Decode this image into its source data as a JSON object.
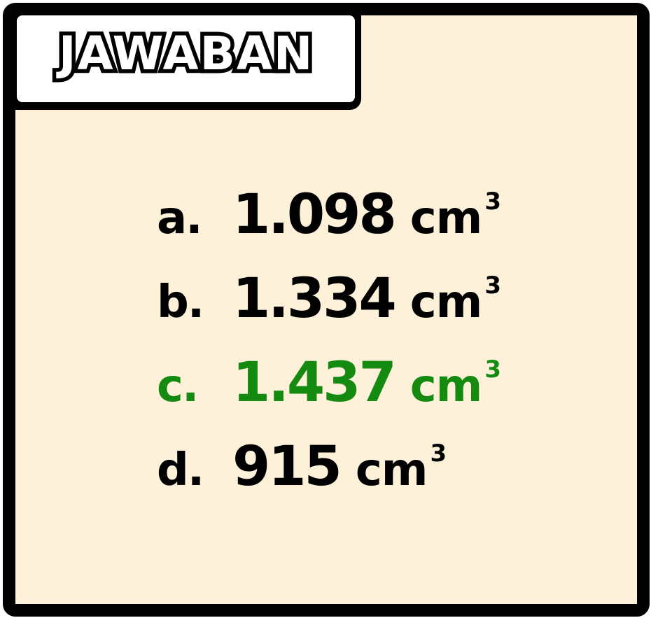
{
  "header": {
    "title": "JAWABAN"
  },
  "answers": [
    {
      "letter": "a.",
      "value": "1.098",
      "unit": "cm",
      "exponent": "3",
      "correct": false
    },
    {
      "letter": "b.",
      "value": "1.334",
      "unit": "cm",
      "exponent": "3",
      "correct": false
    },
    {
      "letter": "c.",
      "value": "1.437",
      "unit": "cm",
      "exponent": "3",
      "correct": true
    },
    {
      "letter": "d.",
      "value": "915",
      "unit": "cm",
      "exponent": "3",
      "correct": false
    }
  ],
  "colors": {
    "background": "#fdf2d9",
    "border": "#000000",
    "correct": "#158a11",
    "text": "#000000"
  }
}
